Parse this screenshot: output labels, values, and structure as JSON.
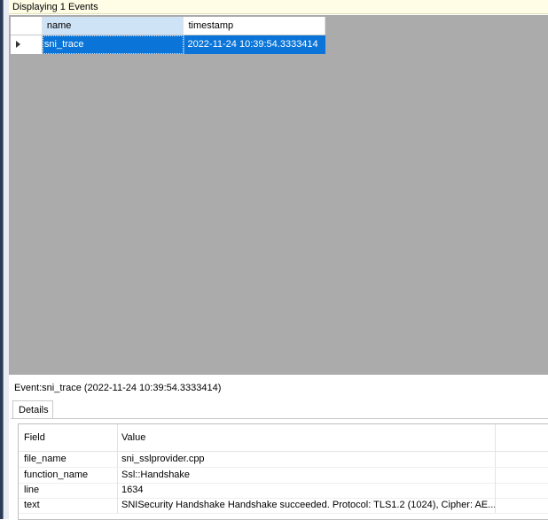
{
  "status": {
    "text": "Displaying 1 Events"
  },
  "grid": {
    "columns": [
      "name",
      "timestamp"
    ],
    "rows": [
      {
        "name": "sni_trace",
        "timestamp": "2022-11-24 10:39:54.3333414"
      }
    ]
  },
  "event": {
    "label": "Event:sni_trace (2022-11-24 10:39:54.3333414)"
  },
  "details": {
    "tab_label": "Details",
    "headers": {
      "field": "Field",
      "value": "Value"
    },
    "rows": [
      {
        "field": "file_name",
        "value": "sni_sslprovider.cpp"
      },
      {
        "field": "function_name",
        "value": "Ssl::Handshake"
      },
      {
        "field": "line",
        "value": "1634"
      },
      {
        "field": "text",
        "value": "SNISecurity Handshake Handshake succeeded. Protocol: TLS1.2 (1024), Cipher: AE..."
      }
    ]
  },
  "colors": {
    "selection": "#0a74d8",
    "grid_background": "#ababab",
    "status_background": "#fffde6"
  }
}
